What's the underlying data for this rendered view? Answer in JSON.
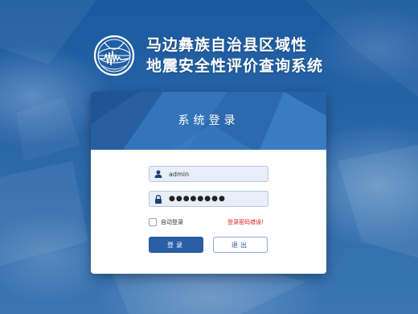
{
  "header": {
    "title_line1": "马边彝族自治县区域性",
    "title_line2": "地震安全性评价查询系统",
    "logo_icon": "seismograph-globe-icon"
  },
  "login": {
    "title": "系统登录",
    "username_value": "admin",
    "password_value": "●●●●●●●●",
    "user_icon": "user-icon",
    "lock_icon": "lock-icon",
    "remember_label": "自动登录",
    "error_message": "登录密码错误!",
    "login_button": "登录",
    "logout_button": "退出"
  },
  "colors": {
    "accent": "#2a5fa6",
    "header_blue": "#2e6fb6",
    "error": "#e02020",
    "field_bg": "#e8eef8"
  }
}
